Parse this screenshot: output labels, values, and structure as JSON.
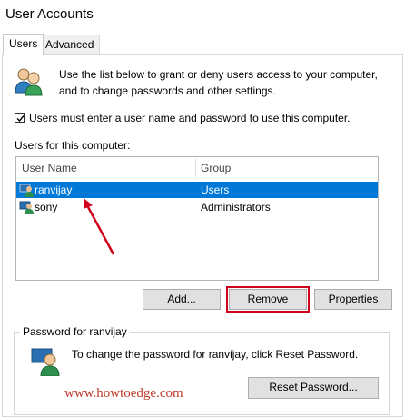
{
  "window": {
    "title": "User Accounts"
  },
  "tabs": [
    {
      "label": "Users",
      "active": true
    },
    {
      "label": "Advanced",
      "active": false
    }
  ],
  "intro": {
    "text": "Use the list below to grant or deny users access to your computer, and to change passwords and other settings.",
    "icon": "users-icon"
  },
  "require_login": {
    "checked": true,
    "label": "Users must enter a user name and password to use this computer."
  },
  "users_list": {
    "label": "Users for this computer:",
    "columns": [
      "User Name",
      "Group"
    ],
    "rows": [
      {
        "name": "ranvijay",
        "group": "Users",
        "selected": true
      },
      {
        "name": "sony",
        "group": "Administrators",
        "selected": false
      }
    ],
    "selection_color": "#0078d7"
  },
  "actions": {
    "add": "Add...",
    "remove": "Remove",
    "properties": "Properties",
    "highlight_color": "#d0021b"
  },
  "password_group": {
    "label": "Password for ranvijay",
    "text": "To change the password for ranvijay, click Reset Password.",
    "reset_button": "Reset Password...",
    "icon": "user-key-icon"
  },
  "watermark": "www.howtoedge.com"
}
